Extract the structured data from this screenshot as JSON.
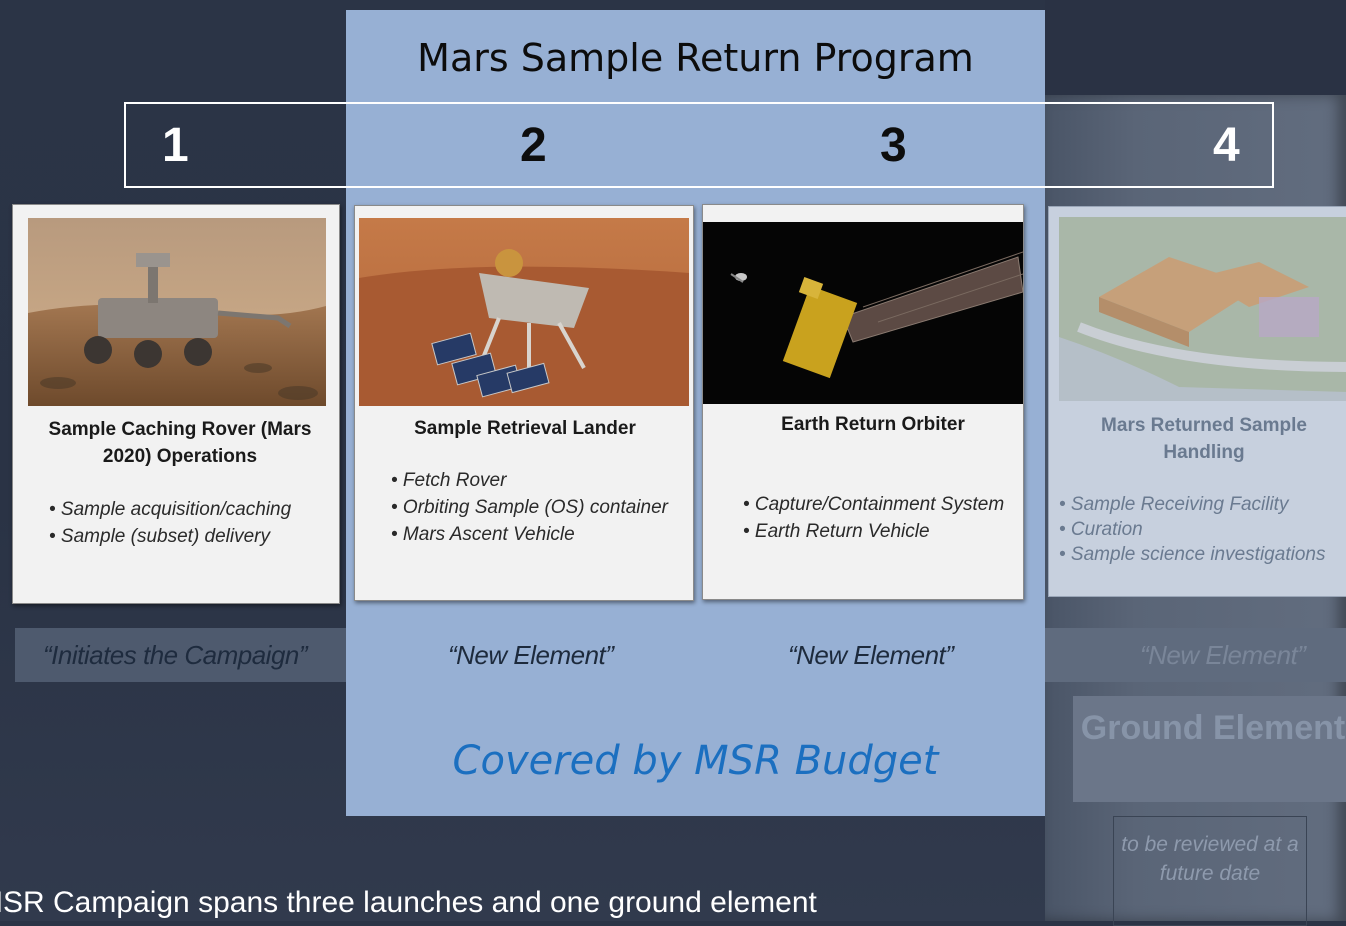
{
  "program_title": "Mars Sample Return Program",
  "numbers": [
    "1",
    "2",
    "3",
    "4"
  ],
  "cards": [
    {
      "title": "Sample Caching Rover (Mars 2020) Operations",
      "bullets": [
        "• Sample acquisition/caching",
        "• Sample (subset) delivery"
      ],
      "image": "mars-2020-rover-image"
    },
    {
      "title": "Sample Retrieval Lander",
      "bullets": [
        "• Fetch Rover",
        "• Orbiting Sample (OS) container",
        "• Mars Ascent Vehicle"
      ],
      "image": "sample-retrieval-lander-image"
    },
    {
      "title": "Earth Return Orbiter",
      "bullets": [
        "• Capture/Containment System",
        "• Earth Return Vehicle"
      ],
      "image": "earth-return-orbiter-image"
    },
    {
      "title": "Mars Returned Sample Handling",
      "bullets": [
        "• Sample Receiving Facility",
        "• Curation",
        "• Sample science investigations"
      ],
      "image": "sample-receiving-facility-image"
    }
  ],
  "quotes": [
    "“Initiates the Campaign”",
    "“New Element”",
    "“New Element”",
    "“New Element”"
  ],
  "covered_text": "Covered by MSR Budget",
  "ground_element": "Ground Element",
  "review_note": "to be reviewed at a future date",
  "footer_text": "MSR Campaign spans three launches and one ground element",
  "colors": {
    "program_panel": "#97b0d4",
    "covered_text": "#1b6fc0",
    "background": "#2b3446"
  }
}
